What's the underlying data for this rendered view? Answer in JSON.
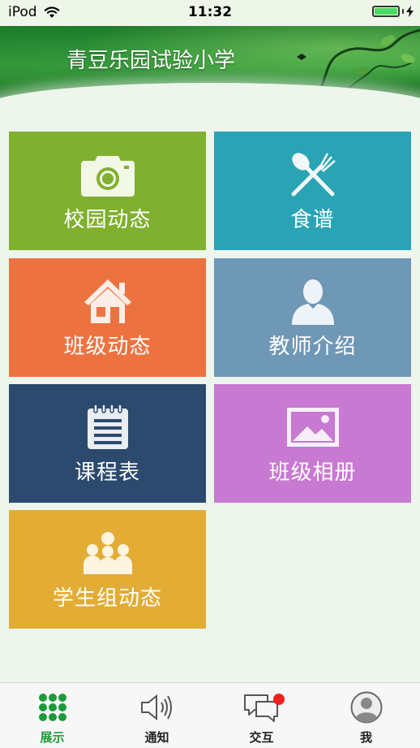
{
  "status_bar": {
    "carrier": "iPod",
    "time": "11:32"
  },
  "header": {
    "title": "青豆乐园试验小学"
  },
  "tiles": [
    {
      "label": "校园动态",
      "color": "#7fb02f",
      "icon": "camera-icon"
    },
    {
      "label": "食谱",
      "color": "#2aa4b4",
      "icon": "spoon-fork-icon"
    },
    {
      "label": "班级动态",
      "color": "#ec7340",
      "icon": "house-icon"
    },
    {
      "label": "教师介绍",
      "color": "#6f97b6",
      "icon": "person-icon"
    },
    {
      "label": "课程表",
      "color": "#2b4a6e",
      "icon": "notepad-icon"
    },
    {
      "label": "班级相册",
      "color": "#c879d2",
      "icon": "picture-icon"
    },
    {
      "label": "学生组动态",
      "color": "#e3ac35",
      "icon": "group-icon"
    }
  ],
  "tabbar": {
    "items": [
      {
        "label": "展示",
        "icon": "grid-dots-icon",
        "active": true
      },
      {
        "label": "通知",
        "icon": "speaker-icon",
        "active": false
      },
      {
        "label": "交互",
        "icon": "chat-bubbles-icon",
        "active": false
      },
      {
        "label": "我",
        "icon": "user-avatar-icon",
        "active": false
      }
    ]
  },
  "colors": {
    "accent": "#1b9a3a",
    "background": "#eef5ec",
    "badge": "#f02020"
  }
}
